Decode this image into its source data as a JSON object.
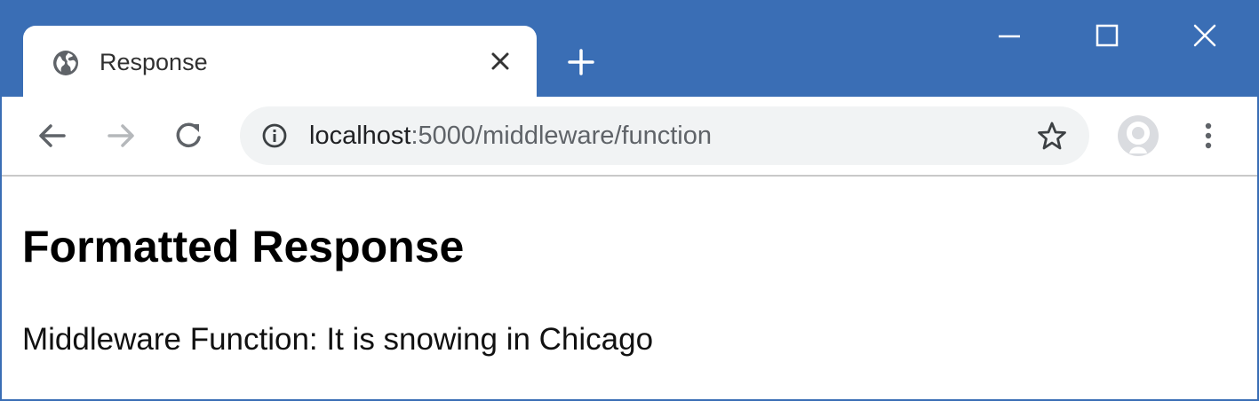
{
  "browser": {
    "tab": {
      "title": "Response",
      "favicon_icon": "globe-icon",
      "close_icon": "close-icon"
    },
    "new_tab_icon": "plus-icon",
    "window_controls": [
      "minimize-icon",
      "maximize-icon",
      "close-icon"
    ],
    "toolbar": {
      "back_icon": "arrow-left-icon",
      "forward_icon": "arrow-right-icon",
      "reload_icon": "reload-icon",
      "site_info_icon": "info-icon",
      "bookmark_icon": "star-icon",
      "profile_icon": "avatar-icon",
      "menu_icon": "kebab-menu-icon"
    },
    "address_bar": {
      "host": "localhost",
      "rest": ":5000/middleware/function"
    }
  },
  "page": {
    "heading": "Formatted Response",
    "paragraph": "Middleware Function: It is snowing in Chicago"
  },
  "colors": {
    "titlebar": "#3a6eb5",
    "omnibox": "#f1f3f4",
    "icon": "#5f6368",
    "icon_disabled": "#b5b8bb"
  }
}
